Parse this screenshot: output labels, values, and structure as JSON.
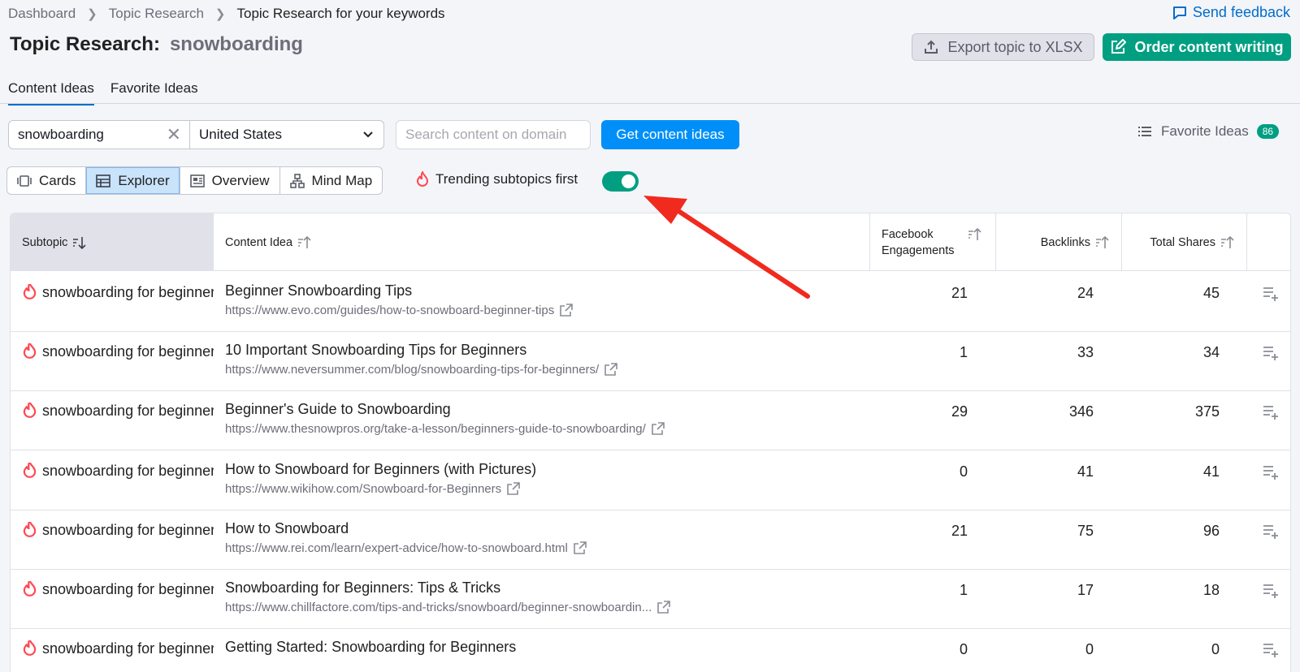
{
  "breadcrumb": [
    "Dashboard",
    "Topic Research",
    "Topic Research for your keywords"
  ],
  "feedback_label": "Send feedback",
  "title": {
    "prefix": "Topic Research:",
    "keyword": "snowboarding"
  },
  "actions": {
    "export_label": "Export topic to XLSX",
    "order_label": "Order content writing"
  },
  "tabs": [
    {
      "label": "Content Ideas",
      "active": true
    },
    {
      "label": "Favorite Ideas",
      "active": false
    }
  ],
  "search": {
    "keyword_value": "snowboarding",
    "country_value": "United States",
    "domain_placeholder": "Search content on domain",
    "submit_label": "Get content ideas"
  },
  "favorites": {
    "label": "Favorite Ideas",
    "count": "86"
  },
  "views": [
    {
      "label": "Cards",
      "icon": "cards-icon",
      "active": false
    },
    {
      "label": "Explorer",
      "icon": "table-icon",
      "active": true
    },
    {
      "label": "Overview",
      "icon": "overview-icon",
      "active": false
    },
    {
      "label": "Mind Map",
      "icon": "mind-map-icon",
      "active": false
    }
  ],
  "trending": {
    "label": "Trending subtopics first",
    "enabled": true
  },
  "table": {
    "headers": {
      "subtopic": "Subtopic",
      "idea": "Content Idea",
      "facebook": "Facebook Engagements",
      "backlinks": "Backlinks",
      "shares": "Total Shares"
    },
    "rows": [
      {
        "subtopic": "snowboarding for beginners",
        "title": "Beginner Snowboarding Tips",
        "url": "https://www.evo.com/guides/how-to-snowboard-beginner-tips",
        "facebook": "21",
        "backlinks": "24",
        "shares": "45"
      },
      {
        "subtopic": "snowboarding for beginners",
        "title": "10 Important Snowboarding Tips for Beginners",
        "url": "https://www.neversummer.com/blog/snowboarding-tips-for-beginners/",
        "facebook": "1",
        "backlinks": "33",
        "shares": "34"
      },
      {
        "subtopic": "snowboarding for beginners",
        "title": "Beginner's Guide to Snowboarding",
        "url": "https://www.thesnowpros.org/take-a-lesson/beginners-guide-to-snowboarding/",
        "facebook": "29",
        "backlinks": "346",
        "shares": "375"
      },
      {
        "subtopic": "snowboarding for beginners",
        "title": "How to Snowboard for Beginners (with Pictures)",
        "url": "https://www.wikihow.com/Snowboard-for-Beginners",
        "facebook": "0",
        "backlinks": "41",
        "shares": "41"
      },
      {
        "subtopic": "snowboarding for beginners",
        "title": "How to Snowboard",
        "url": "https://www.rei.com/learn/expert-advice/how-to-snowboard.html",
        "facebook": "21",
        "backlinks": "75",
        "shares": "96"
      },
      {
        "subtopic": "snowboarding for beginners",
        "title": "Snowboarding for Beginners: Tips & Tricks",
        "url": "https://www.chillfactore.com/tips-and-tricks/snowboard/beginner-snowboardin...",
        "facebook": "1",
        "backlinks": "17",
        "shares": "18"
      },
      {
        "subtopic": "snowboarding for beginners",
        "title": "Getting Started: Snowboarding for Beginners",
        "url": "",
        "facebook": "0",
        "backlinks": "0",
        "shares": "0"
      }
    ]
  },
  "colors": {
    "primary_blue": "#008ff8",
    "brand_green": "#009f81",
    "trending_red": "#ff4953",
    "annotation_red": "#f02a1e"
  }
}
